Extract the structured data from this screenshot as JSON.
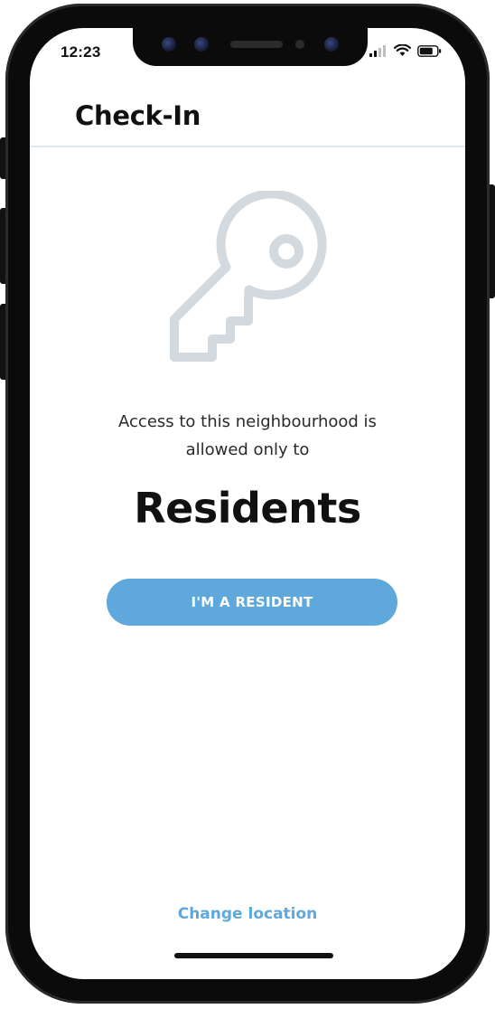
{
  "status_bar": {
    "time": "12:23",
    "icons": [
      "cellular-signal-icon",
      "wifi-icon",
      "battery-icon"
    ]
  },
  "header": {
    "title": "Check-In"
  },
  "illustration": {
    "icon": "key-icon",
    "color": "#d2d9df"
  },
  "main": {
    "message_line1": "Access to this neighbourhood is",
    "message_line2": "allowed only to",
    "headline": "Residents",
    "resident_button_label": "I'M A RESIDENT"
  },
  "footer": {
    "change_location_label": "Change location"
  },
  "colors": {
    "accent": "#5ea8dc",
    "divider": "#dfe6ec"
  }
}
